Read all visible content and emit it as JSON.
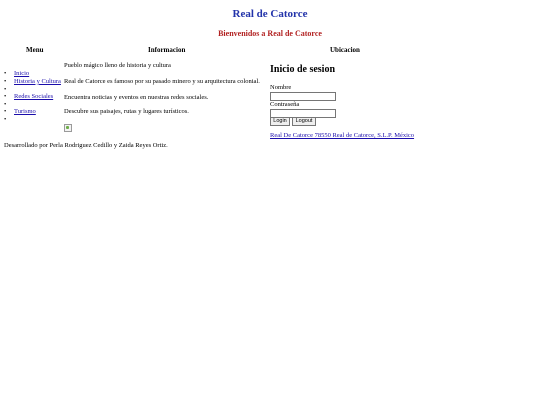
{
  "header": {
    "title": "Real de Catorce",
    "subtitle": "Bienvenidos a Real de Catorce"
  },
  "columns": {
    "menu": "Menu",
    "info": "Informacion",
    "location": "Ubicacion"
  },
  "menu": {
    "items": [
      "Inicio",
      "Historia y Cultura",
      "Redes Sociales",
      "Turismo"
    ]
  },
  "info": {
    "lines": [
      "Pueblo mágico lleno de historia y cultura",
      "Real de Catorce es famoso por su pasado minero y su arquitectura colonial.",
      "Encuentra noticias y eventos en nuestras redes sociales.",
      "Descubre sus paisajes, rutas y lugares turísticos."
    ]
  },
  "login": {
    "title": "Inicio de sesion",
    "name_label": "Nombre",
    "name_value": "",
    "password_label": "Contraseña",
    "password_value": "",
    "login_button": "Login",
    "logout_button": "Logout"
  },
  "location": {
    "address": "Real De Catorce 78550 Real de Catorce, S.L.P. México"
  },
  "footer": {
    "text": "Desarrollado por Perla Rodriguez Cedillo y Zaida Reyes Ortiz."
  },
  "colors": {
    "title": "#2233aa",
    "subtitle": "#b22222",
    "link": "#1a0dab"
  }
}
